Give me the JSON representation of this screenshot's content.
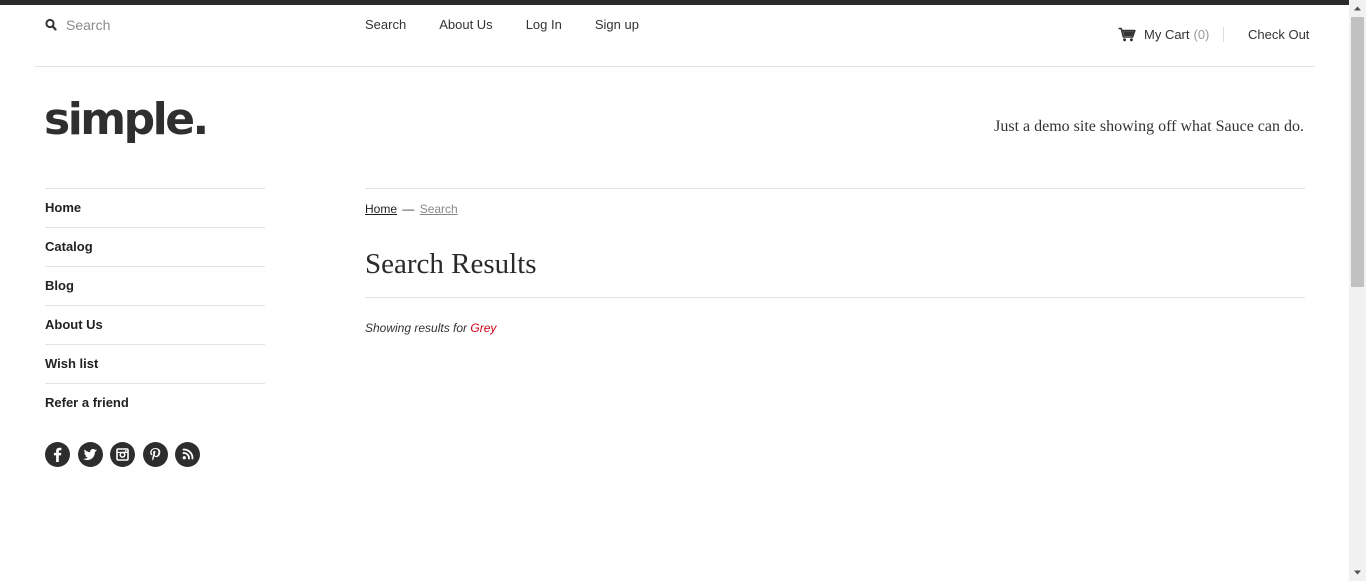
{
  "header": {
    "search_placeholder": "Search",
    "nav": [
      "Search",
      "About Us",
      "Log In",
      "Sign up"
    ],
    "cart_label": "My Cart",
    "cart_count": "(0)",
    "checkout_label": "Check Out"
  },
  "brand": {
    "logo": "simple.",
    "tagline": "Just a demo site showing off what Sauce can do."
  },
  "sidebar": {
    "items": [
      "Home",
      "Catalog",
      "Blog",
      "About Us",
      "Wish list",
      "Refer a friend"
    ],
    "social": [
      "facebook-icon",
      "twitter-icon",
      "instagram-icon",
      "pinterest-icon",
      "rss-icon"
    ]
  },
  "main": {
    "breadcrumb_home": "Home",
    "breadcrumb_separator": "—",
    "breadcrumb_current": "Search",
    "title": "Search Results",
    "results_prefix": "Showing results for",
    "results_term": "Grey"
  },
  "colors": {
    "accent": "#d0021b",
    "topbar": "#2b2b2b"
  }
}
